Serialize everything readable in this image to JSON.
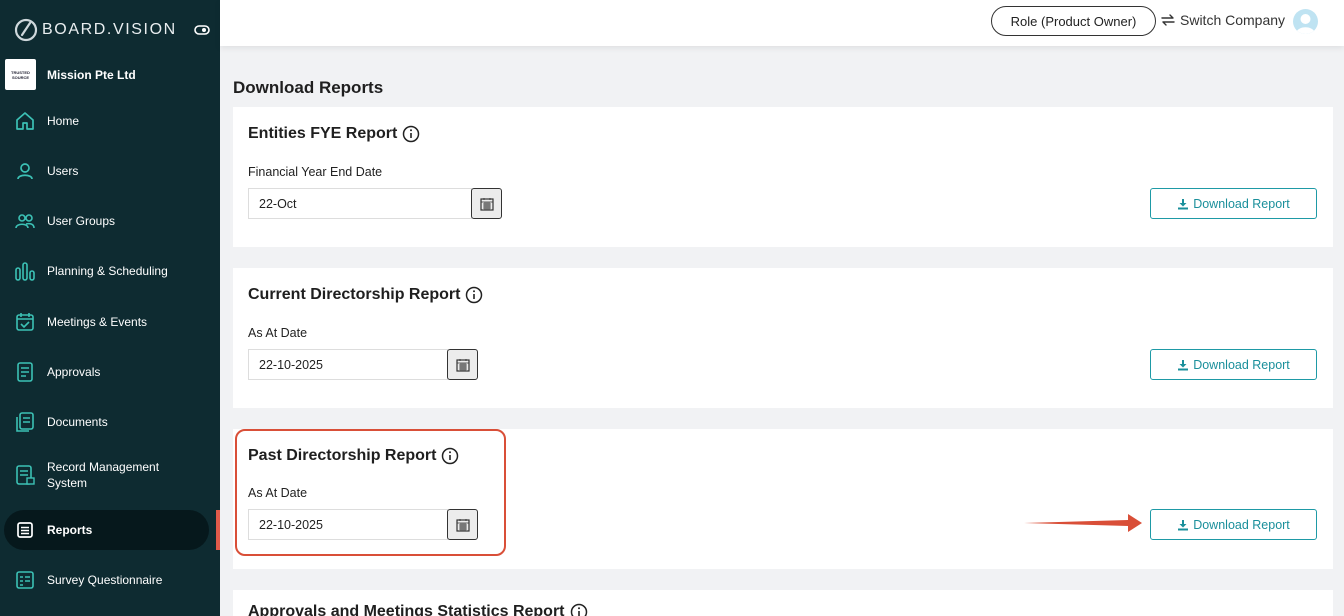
{
  "brand": {
    "name": "BOARD.VISION"
  },
  "company": {
    "name": "Mission Pte Ltd",
    "logo_line1": "TRUSTED",
    "logo_line2": "SOURCE"
  },
  "nav": {
    "items": [
      {
        "label": "Home",
        "icon": "home-icon"
      },
      {
        "label": "Users",
        "icon": "user-icon"
      },
      {
        "label": "User Groups",
        "icon": "user-group-icon"
      },
      {
        "label": "Planning & Scheduling",
        "icon": "bar-chart-icon"
      },
      {
        "label": "Meetings & Events",
        "icon": "calendar-check-icon"
      },
      {
        "label": "Approvals",
        "icon": "document-icon"
      },
      {
        "label": "Documents",
        "icon": "documents-icon"
      },
      {
        "label": "Record Management System",
        "icon": "record-icon"
      },
      {
        "label": "Reports",
        "icon": "reports-icon",
        "active": true
      },
      {
        "label": "Survey Questionnaire",
        "icon": "survey-icon"
      }
    ]
  },
  "topbar": {
    "role_label": "Role (Product Owner)",
    "switch_label": "Switch Company"
  },
  "page": {
    "title": "Download Reports"
  },
  "reports": [
    {
      "title": "Entities FYE Report",
      "field_label": "Financial Year End Date",
      "value": "22-Oct",
      "button": "Download Report"
    },
    {
      "title": "Current Directorship Report",
      "field_label": "As At Date",
      "value": "22-10-2025",
      "button": "Download Report"
    },
    {
      "title": "Past Directorship Report",
      "field_label": "As At Date",
      "value": "22-10-2025",
      "button": "Download Report"
    },
    {
      "title": "Approvals and Meetings Statistics Report"
    }
  ],
  "colors": {
    "sidebar": "#0e2b31",
    "accent": "#1a8f9b",
    "highlight": "#d94f38",
    "icon_teal": "#3cc1b5"
  }
}
